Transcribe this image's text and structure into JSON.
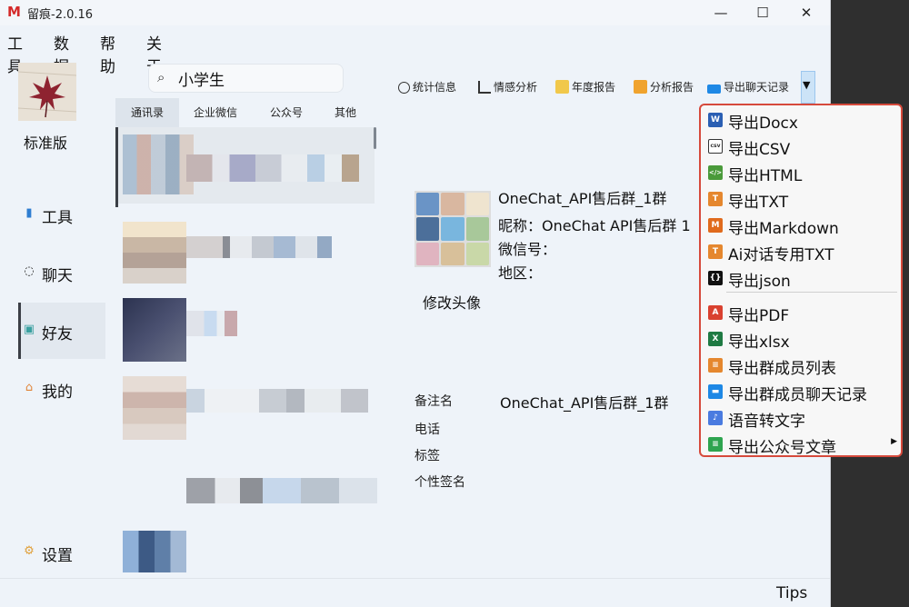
{
  "window": {
    "title": "留痕-2.0.16",
    "logo": "M",
    "controls": {
      "minimize": "—",
      "maximize": "☐",
      "close": "✕"
    }
  },
  "menubar": [
    "工具",
    "数据",
    "帮助",
    "关于"
  ],
  "sidebar": {
    "edition": "标准版",
    "items": [
      {
        "label": "工具",
        "icon": "tools-icon"
      },
      {
        "label": "聊天",
        "icon": "chat-icon"
      },
      {
        "label": "好友",
        "icon": "contacts-icon",
        "active": true
      },
      {
        "label": "我的",
        "icon": "home-icon"
      },
      {
        "label": "设置",
        "icon": "settings-icon"
      }
    ]
  },
  "search": {
    "value": "小学生"
  },
  "tabs": [
    "通讯录",
    "企业微信",
    "公众号",
    "其他"
  ],
  "toolbar": {
    "stats": "统计信息",
    "emotion": "情感分析",
    "annual": "年度报告",
    "analysis": "分析报告",
    "export": "导出聊天记录"
  },
  "profile": {
    "name": "OneChat_API售后群_1群",
    "nickname": "昵称：OneChat API售后群 1",
    "wechat_id": "微信号：",
    "region": "地区：",
    "edit_avatar": "修改头像",
    "remark_label": "备注名",
    "remark_value": "OneChat_API售后群_1群",
    "phone_label": "电话",
    "tag_label": "标签",
    "signature_label": "个性签名"
  },
  "export_menu": [
    {
      "label": "导出Docx",
      "icon": "word-icon",
      "color": "#2b5fb3",
      "glyph": "W"
    },
    {
      "label": "导出CSV",
      "icon": "csv-icon",
      "color": "#ffffff",
      "glyph": "csv"
    },
    {
      "label": "导出HTML",
      "icon": "html-icon",
      "color": "#4a9a3a",
      "glyph": "</>"
    },
    {
      "label": "导出TXT",
      "icon": "txt-icon",
      "color": "#e5872e",
      "glyph": "T"
    },
    {
      "label": "导出Markdown",
      "icon": "markdown-icon",
      "color": "#e06a1c",
      "glyph": "M"
    },
    {
      "label": "Ai对话专用TXT",
      "icon": "ai-txt-icon",
      "color": "#e5872e",
      "glyph": "T"
    },
    {
      "label": "导出json",
      "icon": "json-icon",
      "color": "#111111",
      "glyph": "{}"
    },
    {
      "label": "导出PDF",
      "icon": "pdf-icon",
      "color": "#d9412f",
      "glyph": "A"
    },
    {
      "label": "导出xlsx",
      "icon": "excel-icon",
      "color": "#1f7a43",
      "glyph": "X"
    },
    {
      "label": "导出群成员列表",
      "icon": "member-list-icon",
      "color": "#e5872e",
      "glyph": "≡"
    },
    {
      "label": "导出群成员聊天记录",
      "icon": "member-chat-icon",
      "color": "#1e88e5",
      "glyph": "▬"
    },
    {
      "label": "语音转文字",
      "icon": "voice-icon",
      "color": "#4a7be0",
      "glyph": "♪"
    },
    {
      "label": "导出公众号文章",
      "icon": "article-icon",
      "color": "#2ea44f",
      "glyph": "≡",
      "submenu": true
    }
  ],
  "tips": "Tips"
}
